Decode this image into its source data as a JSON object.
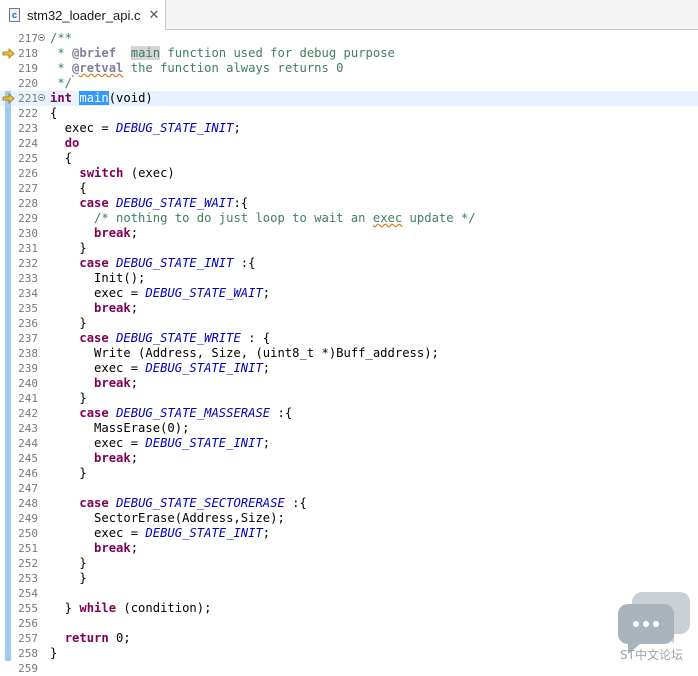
{
  "tab": {
    "title": "stm32_loader_api.c",
    "close": "✕",
    "icon_letter": "c"
  },
  "watermark": {
    "text": "ST中文论坛"
  },
  "lines": [
    {
      "n": "217",
      "fold": true,
      "tokens": [
        [
          "cm",
          "/**"
        ]
      ]
    },
    {
      "n": "218",
      "arrow": true,
      "tokens": [
        [
          "cm",
          " * "
        ],
        [
          "cmtag",
          "@brief"
        ],
        [
          "cm",
          "  "
        ],
        [
          "cm hl",
          "main"
        ],
        [
          "cm",
          " function used for debug purpose"
        ]
      ]
    },
    {
      "n": "219",
      "tokens": [
        [
          "cm",
          " * "
        ],
        [
          "cmtag sq",
          "@retval"
        ],
        [
          "cm",
          " the function always returns 0"
        ]
      ]
    },
    {
      "n": "220",
      "tokens": [
        [
          "cm",
          " */"
        ]
      ]
    },
    {
      "n": "221",
      "arrow": true,
      "fold": true,
      "current": true,
      "tokens": [
        [
          "kw",
          "int"
        ],
        [
          "",
          " "
        ],
        [
          "sel",
          "main"
        ],
        [
          "",
          "(void)"
        ]
      ]
    },
    {
      "n": "222",
      "tokens": [
        [
          "",
          "{"
        ]
      ]
    },
    {
      "n": "223",
      "tokens": [
        [
          "",
          "  exec = "
        ],
        [
          "mc",
          "DEBUG_STATE_INIT"
        ],
        [
          "",
          ";"
        ]
      ]
    },
    {
      "n": "224",
      "tokens": [
        [
          "",
          "  "
        ],
        [
          "kw",
          "do"
        ]
      ]
    },
    {
      "n": "225",
      "tokens": [
        [
          "",
          "  {"
        ]
      ]
    },
    {
      "n": "226",
      "tokens": [
        [
          "",
          "    "
        ],
        [
          "kw",
          "switch"
        ],
        [
          "",
          " (exec)"
        ]
      ]
    },
    {
      "n": "227",
      "tokens": [
        [
          "",
          "    {"
        ]
      ]
    },
    {
      "n": "228",
      "tokens": [
        [
          "",
          "    "
        ],
        [
          "kw",
          "case"
        ],
        [
          "",
          " "
        ],
        [
          "mc",
          "DEBUG_STATE_WAIT"
        ],
        [
          "",
          ":{"
        ]
      ]
    },
    {
      "n": "229",
      "tokens": [
        [
          "",
          "      "
        ],
        [
          "cm",
          "/* nothing to do just loop to wait an "
        ],
        [
          "cm sq",
          "exec"
        ],
        [
          "cm",
          " update */"
        ]
      ]
    },
    {
      "n": "230",
      "tokens": [
        [
          "",
          "      "
        ],
        [
          "kw",
          "break"
        ],
        [
          "",
          ";"
        ]
      ]
    },
    {
      "n": "231",
      "tokens": [
        [
          "",
          "    }"
        ]
      ]
    },
    {
      "n": "232",
      "tokens": [
        [
          "",
          "    "
        ],
        [
          "kw",
          "case"
        ],
        [
          "",
          " "
        ],
        [
          "mc",
          "DEBUG_STATE_INIT"
        ],
        [
          "",
          " :{"
        ]
      ]
    },
    {
      "n": "233",
      "tokens": [
        [
          "",
          "      Init();"
        ]
      ]
    },
    {
      "n": "234",
      "tokens": [
        [
          "",
          "      exec = "
        ],
        [
          "mc",
          "DEBUG_STATE_WAIT"
        ],
        [
          "",
          ";"
        ]
      ]
    },
    {
      "n": "235",
      "tokens": [
        [
          "",
          "      "
        ],
        [
          "kw",
          "break"
        ],
        [
          "",
          ";"
        ]
      ]
    },
    {
      "n": "236",
      "tokens": [
        [
          "",
          "    }"
        ]
      ]
    },
    {
      "n": "237",
      "tokens": [
        [
          "",
          "    "
        ],
        [
          "kw",
          "case"
        ],
        [
          "",
          " "
        ],
        [
          "mc",
          "DEBUG_STATE_WRITE"
        ],
        [
          "",
          " : {"
        ]
      ]
    },
    {
      "n": "238",
      "tokens": [
        [
          "",
          "      Write (Address, Size, (uint8_t *)Buff_address);"
        ]
      ]
    },
    {
      "n": "239",
      "tokens": [
        [
          "",
          "      exec = "
        ],
        [
          "mc",
          "DEBUG_STATE_INIT"
        ],
        [
          "",
          ";"
        ]
      ]
    },
    {
      "n": "240",
      "tokens": [
        [
          "",
          "      "
        ],
        [
          "kw",
          "break"
        ],
        [
          "",
          ";"
        ]
      ]
    },
    {
      "n": "241",
      "tokens": [
        [
          "",
          "    }"
        ]
      ]
    },
    {
      "n": "242",
      "tokens": [
        [
          "",
          "    "
        ],
        [
          "kw",
          "case"
        ],
        [
          "",
          " "
        ],
        [
          "mc",
          "DEBUG_STATE_MASSERASE"
        ],
        [
          "",
          " :{"
        ]
      ]
    },
    {
      "n": "243",
      "tokens": [
        [
          "",
          "      MassErase(0);"
        ]
      ]
    },
    {
      "n": "244",
      "tokens": [
        [
          "",
          "      exec = "
        ],
        [
          "mc",
          "DEBUG_STATE_INIT"
        ],
        [
          "",
          ";"
        ]
      ]
    },
    {
      "n": "245",
      "tokens": [
        [
          "",
          "      "
        ],
        [
          "kw",
          "break"
        ],
        [
          "",
          ";"
        ]
      ]
    },
    {
      "n": "246",
      "tokens": [
        [
          "",
          "    }"
        ]
      ]
    },
    {
      "n": "247",
      "tokens": []
    },
    {
      "n": "248",
      "tokens": [
        [
          "",
          "    "
        ],
        [
          "kw",
          "case"
        ],
        [
          "",
          " "
        ],
        [
          "mc",
          "DEBUG_STATE_SECTORERASE"
        ],
        [
          "",
          " :{"
        ]
      ]
    },
    {
      "n": "249",
      "tokens": [
        [
          "",
          "      SectorErase(Address,Size);"
        ]
      ]
    },
    {
      "n": "250",
      "tokens": [
        [
          "",
          "      exec = "
        ],
        [
          "mc",
          "DEBUG_STATE_INIT"
        ],
        [
          "",
          ";"
        ]
      ]
    },
    {
      "n": "251",
      "tokens": [
        [
          "",
          "      "
        ],
        [
          "kw",
          "break"
        ],
        [
          "",
          ";"
        ]
      ]
    },
    {
      "n": "252",
      "tokens": [
        [
          "",
          "    }"
        ]
      ]
    },
    {
      "n": "253",
      "tokens": [
        [
          "",
          "    }"
        ]
      ]
    },
    {
      "n": "254",
      "tokens": []
    },
    {
      "n": "255",
      "tokens": [
        [
          "",
          "  } "
        ],
        [
          "kw",
          "while"
        ],
        [
          "",
          " (condition);"
        ]
      ]
    },
    {
      "n": "256",
      "tokens": []
    },
    {
      "n": "257",
      "tokens": [
        [
          "",
          "  "
        ],
        [
          "kw",
          "return"
        ],
        [
          "",
          " 0;"
        ]
      ]
    },
    {
      "n": "258",
      "tokens": [
        [
          "",
          "}"
        ]
      ]
    },
    {
      "n": "259",
      "tokens": []
    }
  ]
}
